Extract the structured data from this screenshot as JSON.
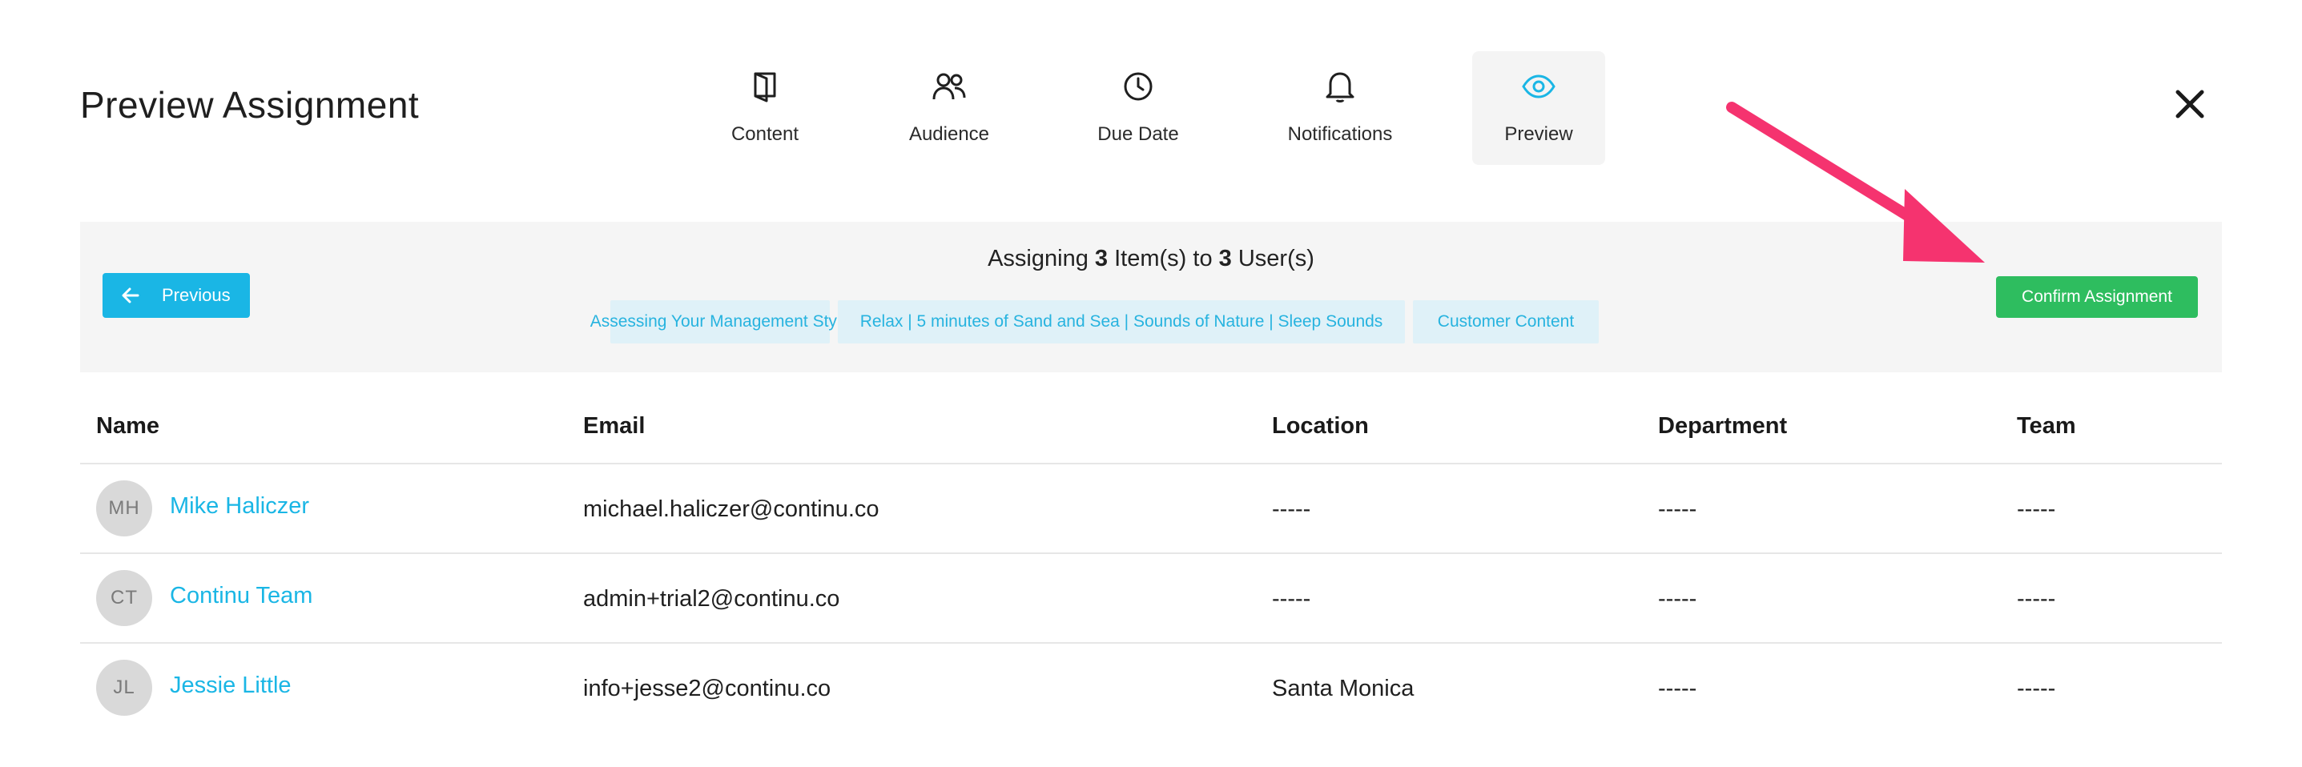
{
  "header": {
    "title": "Preview Assignment"
  },
  "steps": [
    {
      "label": "Content",
      "icon": "book-icon"
    },
    {
      "label": "Audience",
      "icon": "users-icon"
    },
    {
      "label": "Due Date",
      "icon": "clock-icon"
    },
    {
      "label": "Notifications",
      "icon": "bell-icon"
    },
    {
      "label": "Preview",
      "icon": "eye-icon",
      "active": true
    }
  ],
  "banner": {
    "previous_label": "Previous",
    "summary_prefix": "Assigning",
    "item_count": "3",
    "summary_mid": "Item(s) to",
    "user_count": "3",
    "summary_suffix": "User(s)",
    "items": [
      "Assessing Your Management Style",
      "Relax | 5 minutes of Sand and Sea | Sounds of Nature | Sleep Sounds",
      "Customer Content"
    ],
    "confirm_label": "Confirm Assignment"
  },
  "table": {
    "headers": {
      "name": "Name",
      "email": "Email",
      "location": "Location",
      "department": "Department",
      "team": "Team"
    },
    "rows": [
      {
        "initials": "MH",
        "name": "Mike Haliczer",
        "email": "michael.haliczer@continu.co",
        "location": "-----",
        "department": "-----",
        "team": "-----"
      },
      {
        "initials": "CT",
        "name": "Continu Team",
        "email": "admin+trial2@continu.co",
        "location": "-----",
        "department": "-----",
        "team": "-----"
      },
      {
        "initials": "JL",
        "name": "Jessie Little",
        "email": "info+jesse2@continu.co",
        "location": "Santa Monica",
        "department": "-----",
        "team": "-----"
      }
    ]
  },
  "colors": {
    "accent": "#1ab6e5",
    "confirm": "#2ebd5f",
    "chip_bg": "#dff1f8",
    "annotation_arrow": "#f5336f"
  }
}
